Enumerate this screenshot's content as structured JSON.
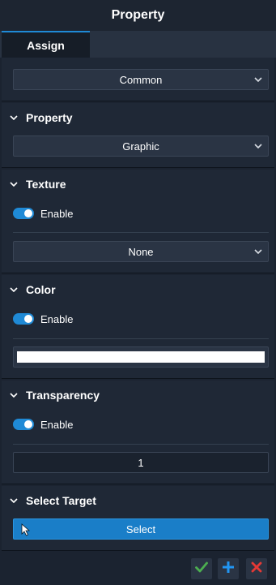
{
  "window": {
    "title": "Property"
  },
  "tabs": [
    {
      "label": "Assign",
      "active": true
    }
  ],
  "common": {
    "selected": "Common"
  },
  "property": {
    "title": "Property",
    "selected": "Graphic"
  },
  "texture": {
    "title": "Texture",
    "enable_label": "Enable",
    "enabled": true,
    "selected": "None"
  },
  "color": {
    "title": "Color",
    "enable_label": "Enable",
    "enabled": true,
    "value": "#ffffff"
  },
  "transparency": {
    "title": "Transparency",
    "enable_label": "Enable",
    "enabled": true,
    "value": "1"
  },
  "select_target": {
    "title": "Select Target",
    "button_label": "Select"
  },
  "footer": {
    "confirm_icon": "check-icon",
    "add_icon": "plus-icon",
    "close_icon": "close-icon"
  },
  "colors": {
    "accent": "#1f8ad6",
    "confirm": "#4caf50",
    "add": "#2196f3",
    "close": "#e53935"
  }
}
